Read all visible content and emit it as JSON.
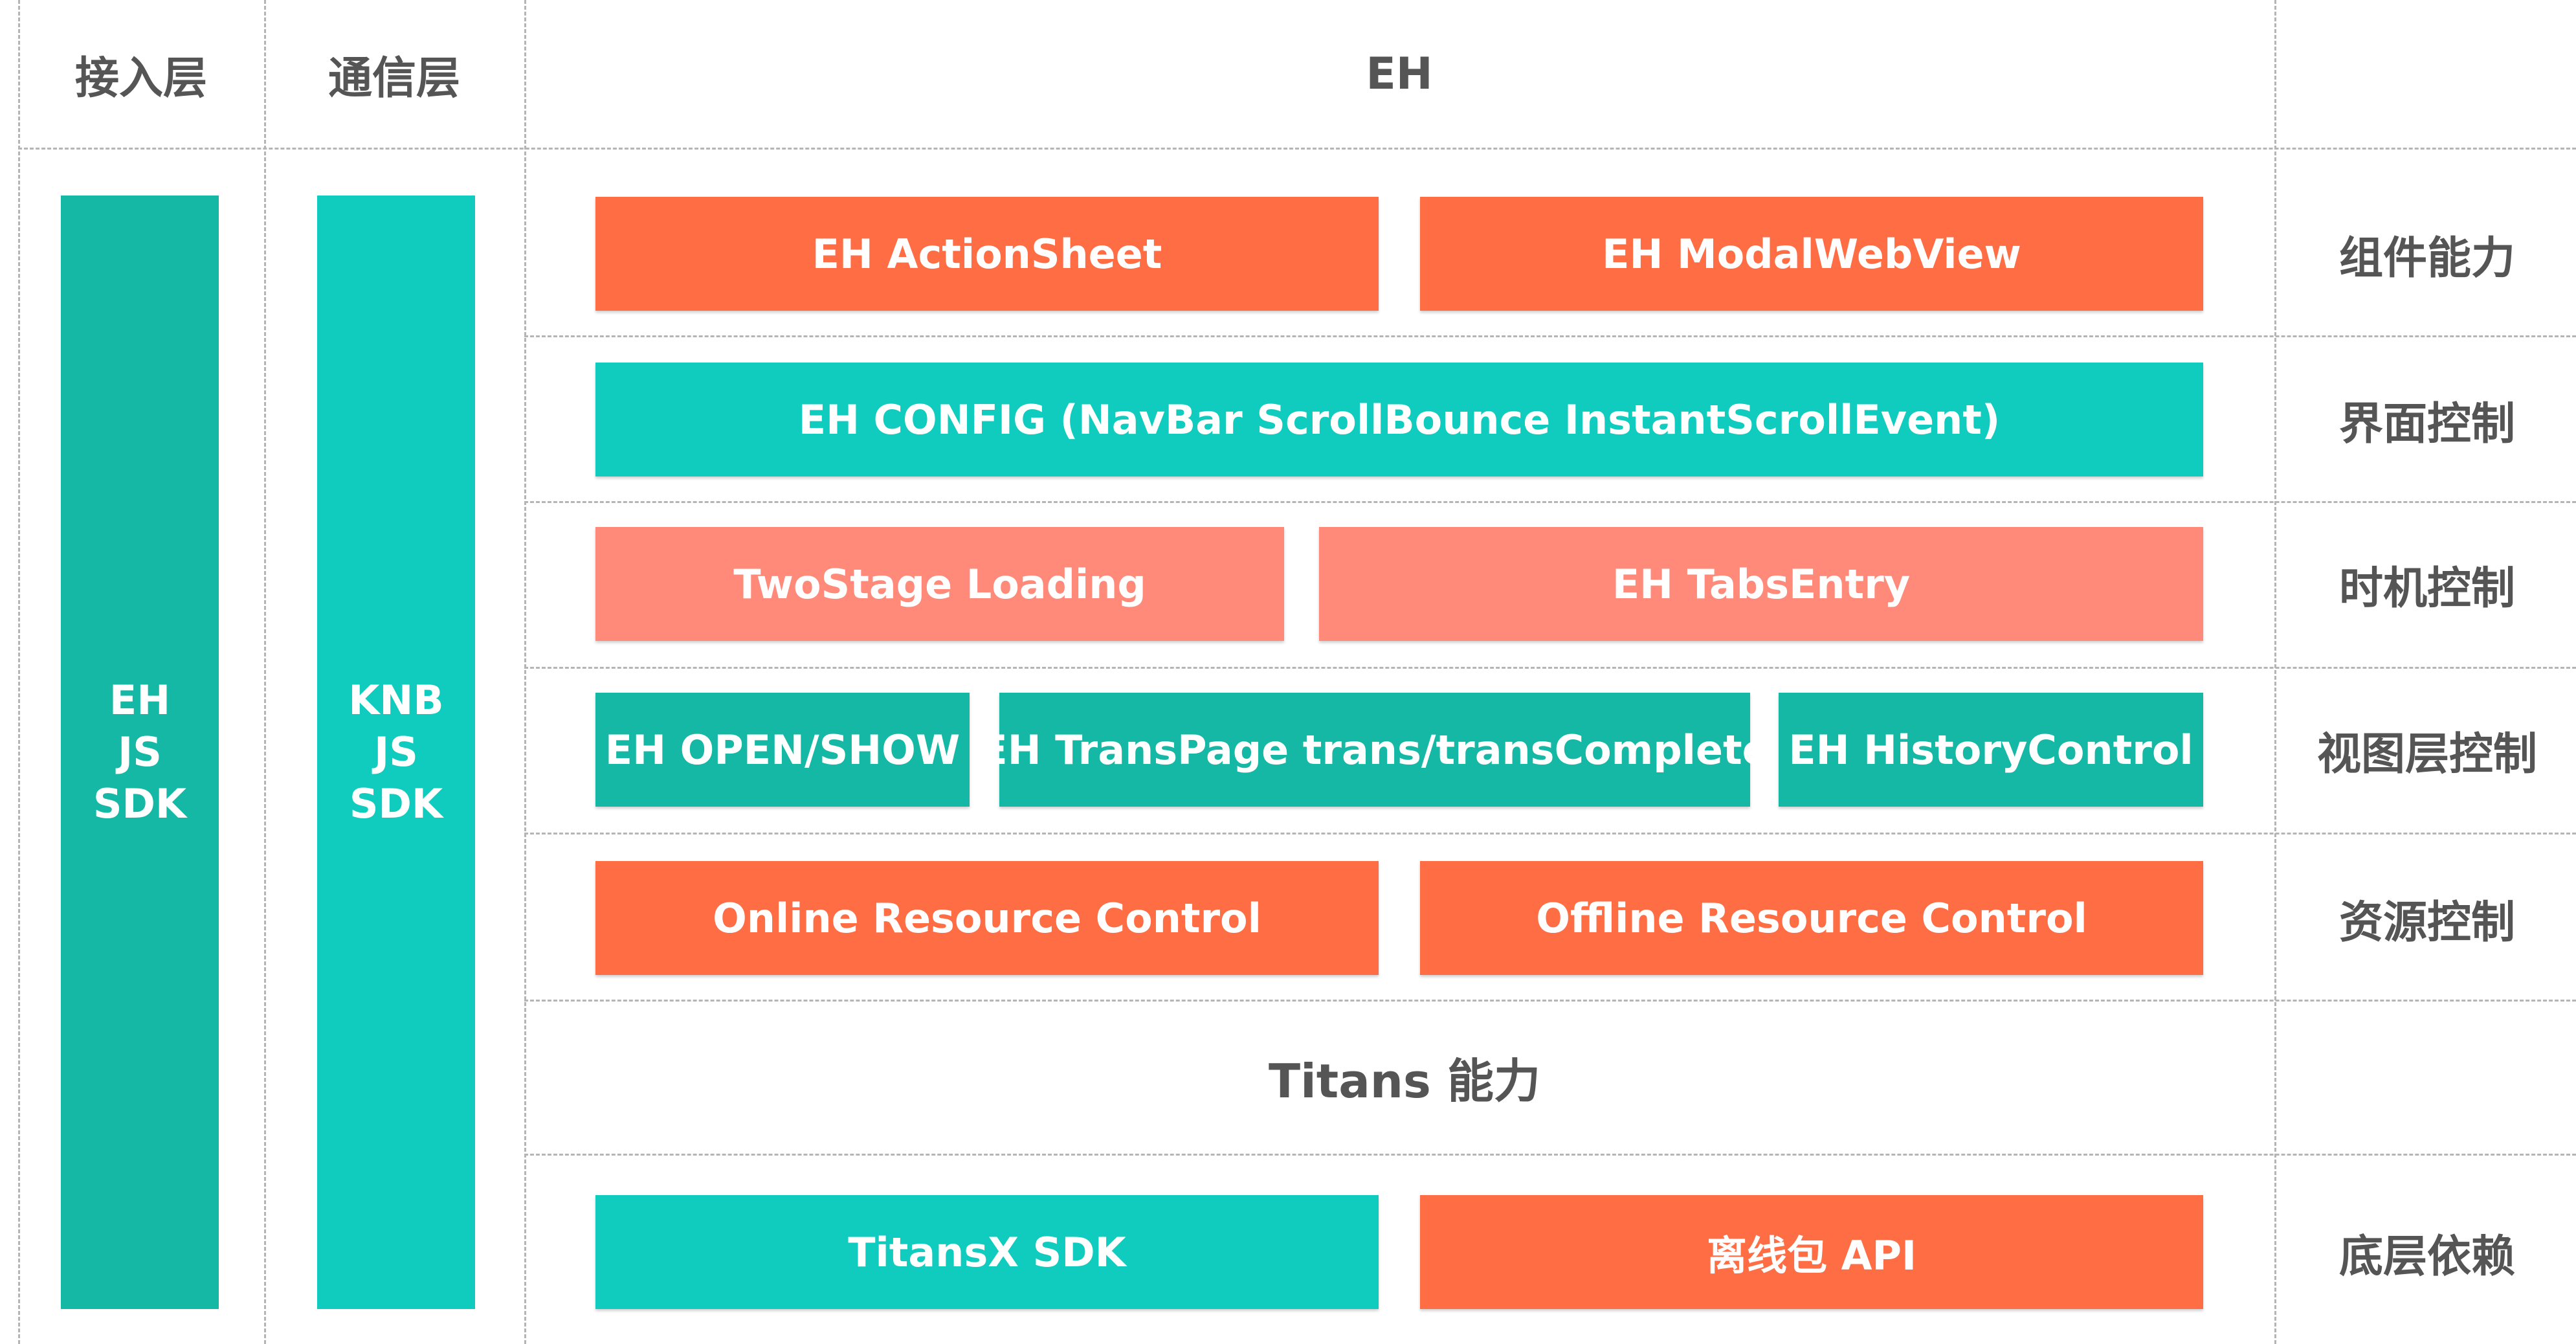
{
  "headers": {
    "access_layer": "接入层",
    "comm_layer": "通信层",
    "eh": "EH"
  },
  "side_columns": {
    "eh_sdk": [
      "EH",
      "JS",
      "SDK"
    ],
    "knb_sdk": [
      "KNB",
      "JS",
      "SDK"
    ]
  },
  "rows": {
    "component": {
      "label": "组件能力",
      "boxes": [
        "EH ActionSheet",
        "EH ModalWebView"
      ]
    },
    "ui_control": {
      "label": "界面控制",
      "boxes": [
        "EH CONFIG (NavBar ScrollBounce InstantScrollEvent)"
      ]
    },
    "timing_control": {
      "label": "时机控制",
      "boxes": [
        "TwoStage Loading",
        "EH TabsEntry"
      ]
    },
    "view_layer_control": {
      "label": "视图层控制",
      "boxes": [
        "EH OPEN/SHOW",
        "EH TransPage trans/transComplete",
        "EH HistoryControl"
      ]
    },
    "resource_control": {
      "label": "资源控制",
      "boxes": [
        "Online Resource Control",
        "Offline Resource Control"
      ]
    },
    "titans": {
      "label": "Titans 能力"
    },
    "dependency": {
      "label": "底层依赖",
      "boxes": [
        "TitansX SDK",
        "离线包 API"
      ]
    }
  },
  "colors": {
    "orange": "#ff6d45",
    "teal": "#10ccbe",
    "teal_dark": "#14b8a4",
    "salmon": "#ff8a7a",
    "text": "#555555",
    "dash": "#b5b5b5"
  }
}
